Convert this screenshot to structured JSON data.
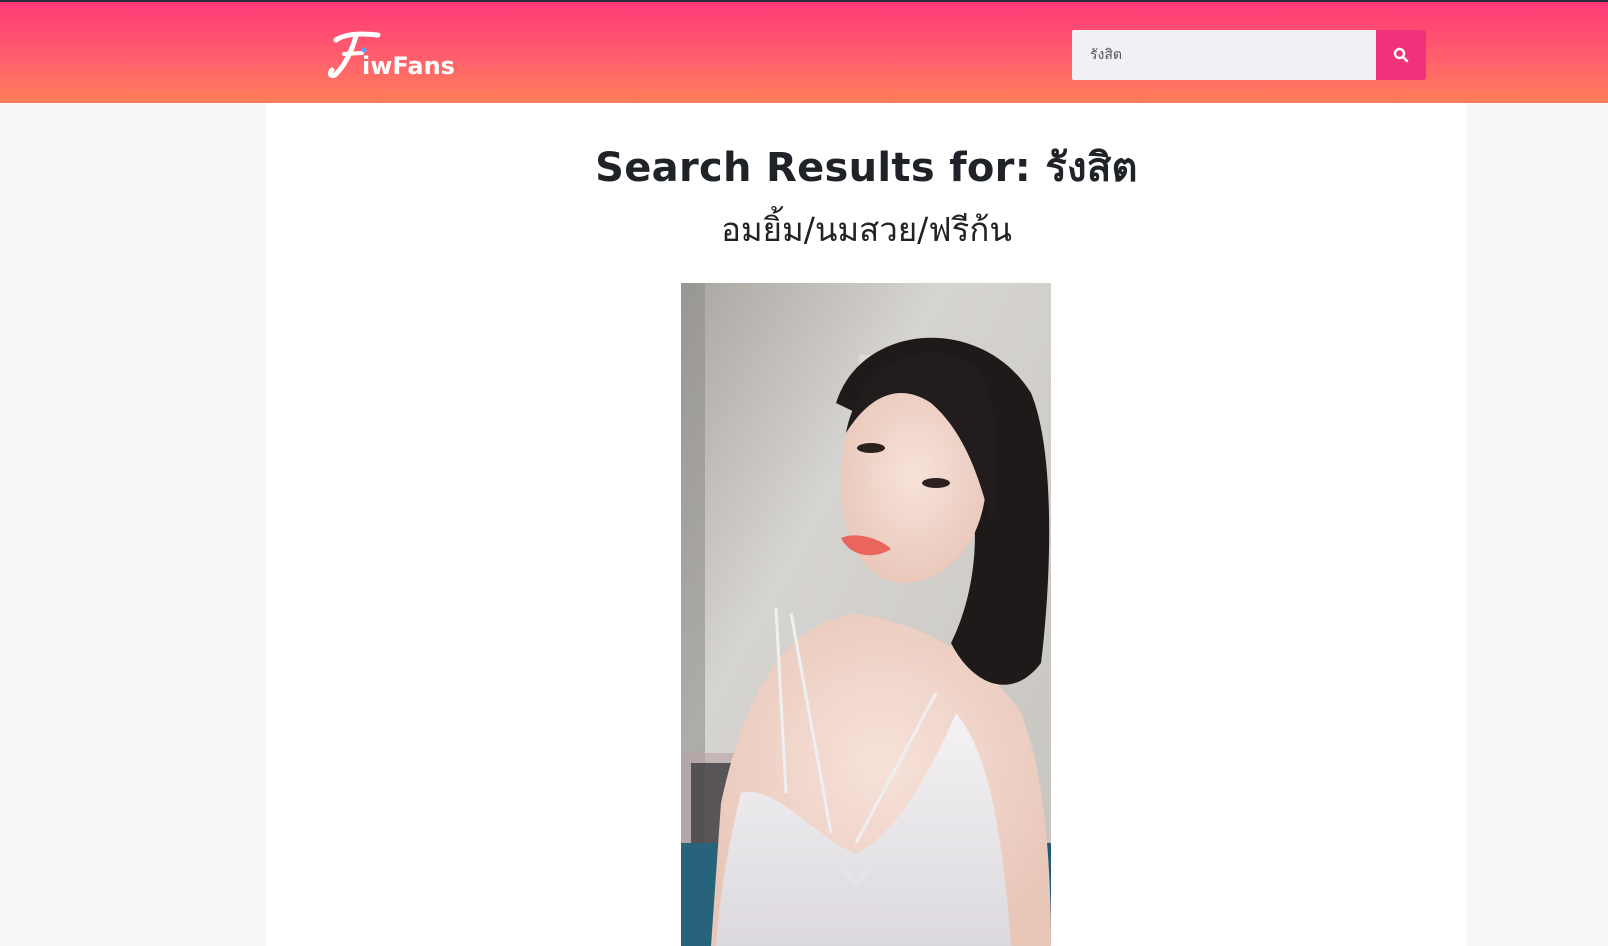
{
  "header": {
    "logo_text": "FiwFans",
    "search": {
      "value": "รังสิต",
      "button_icon": "search-icon"
    }
  },
  "main": {
    "page_title": "Search Results for: รังสิต",
    "results": [
      {
        "title": "อมยิ้ม/นมสวย/ฟรีก้น"
      }
    ]
  },
  "colors": {
    "header_gradient_top": "#ff3a78",
    "header_gradient_bottom": "#ff7f58",
    "search_button": "#f1317a",
    "page_background": "#f6f7f9",
    "content_background": "#ffffff"
  }
}
